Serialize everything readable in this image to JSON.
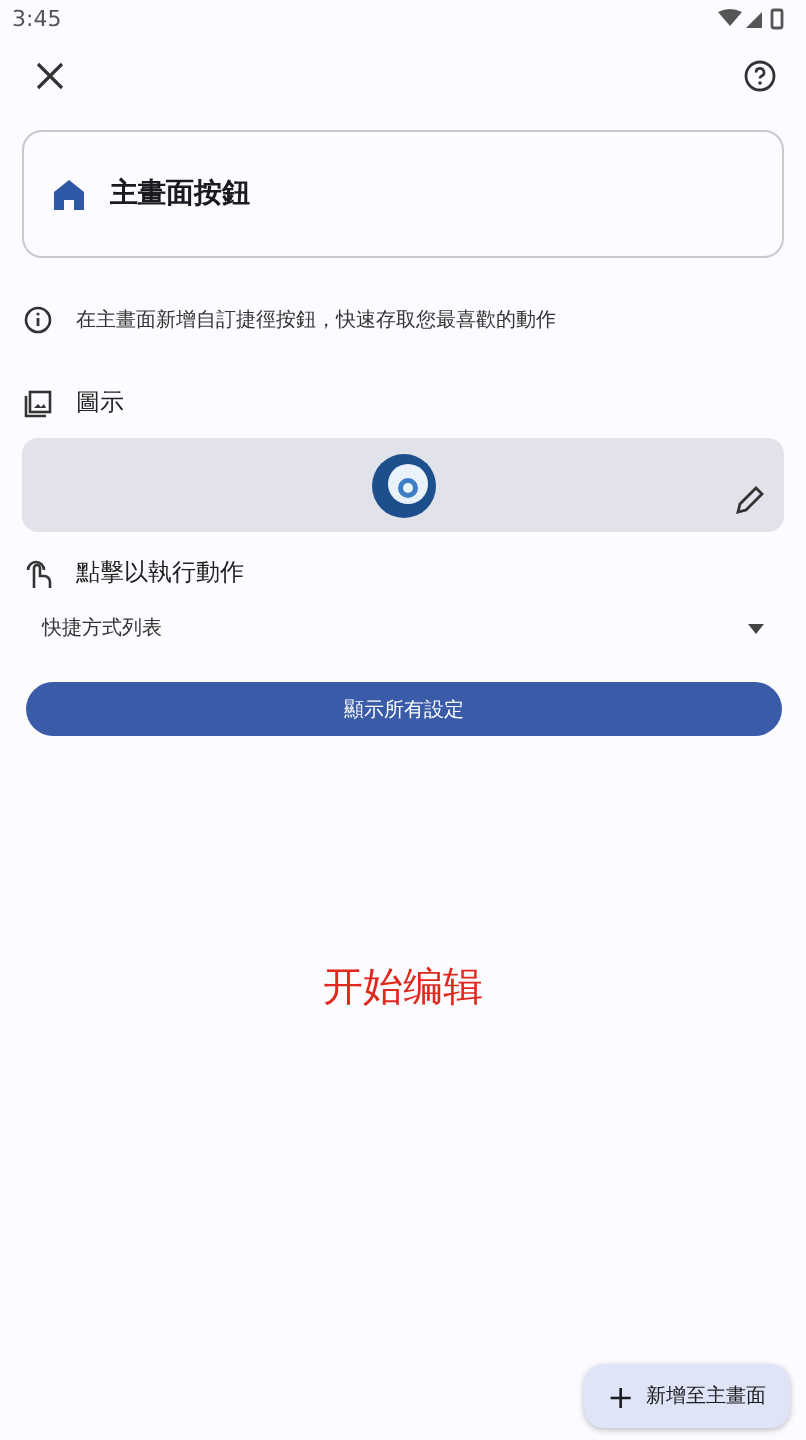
{
  "status_bar": {
    "time": "3:45"
  },
  "shortcut": {
    "title": "主畫面按鈕"
  },
  "info": "在主畫面新增自訂捷徑按鈕，快速存取您最喜歡的動作",
  "icon_section": {
    "label": "圖示"
  },
  "tap_section": {
    "label": "點擊以執行動作",
    "dropdown_value": "快捷方式列表"
  },
  "show_all_button": "顯示所有設定",
  "caption": "开始编辑",
  "fab": {
    "icon": "+",
    "label": "新增至主畫面"
  }
}
